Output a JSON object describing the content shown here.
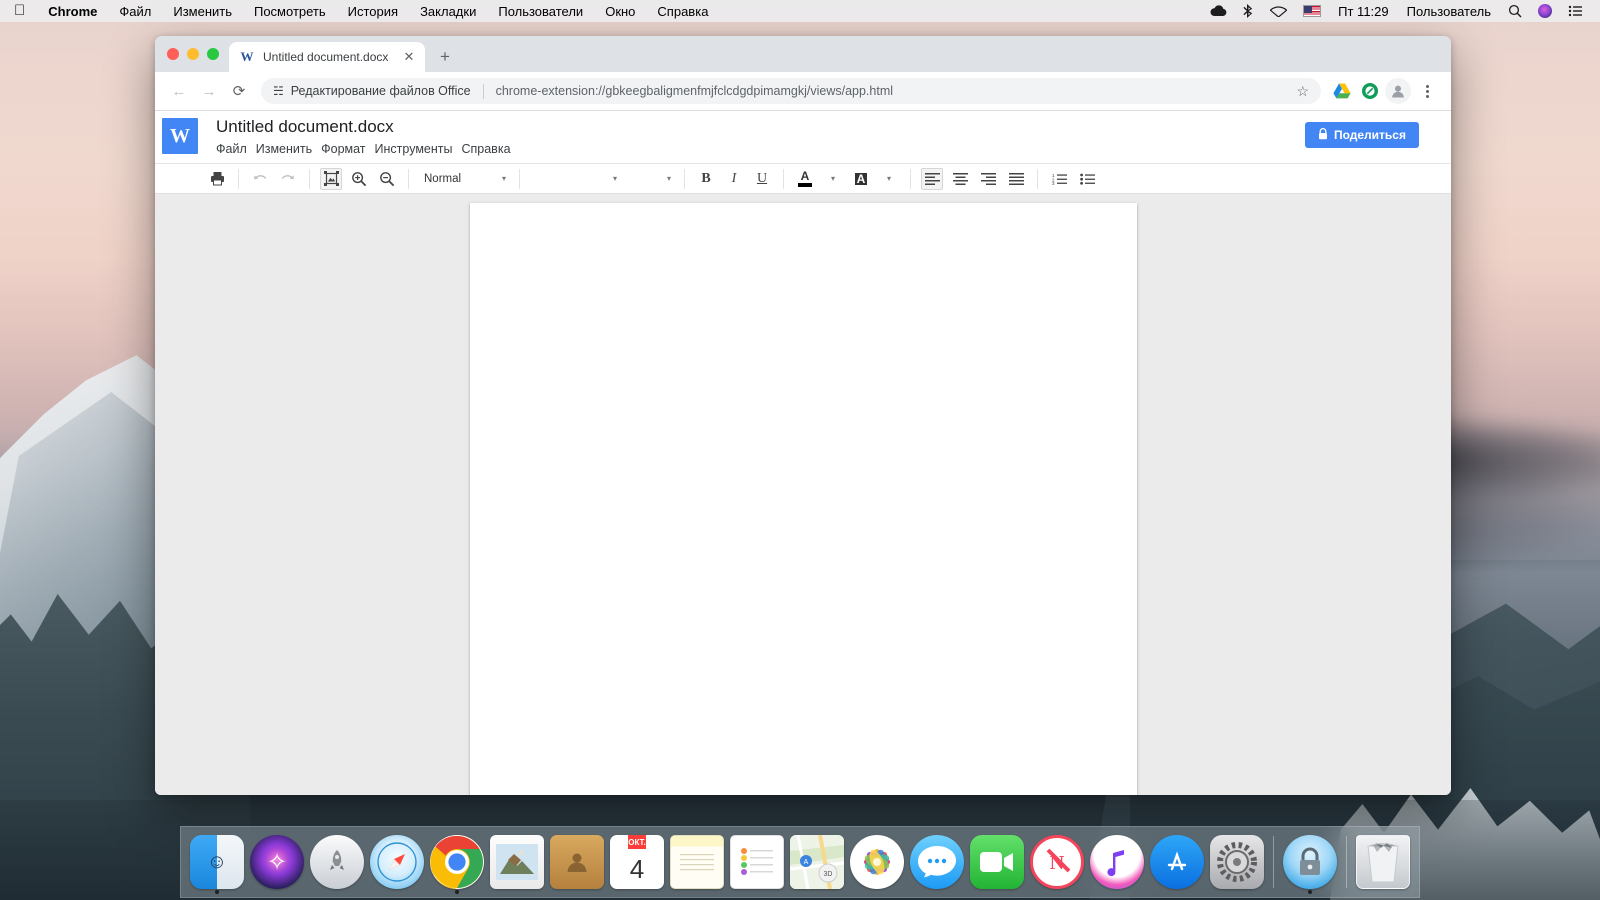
{
  "menubar": {
    "apple_icon": "apple-logo",
    "app_name": "Chrome",
    "items": [
      "Файл",
      "Изменить",
      "Посмотреть",
      "История",
      "Закладки",
      "Пользователи",
      "Окно",
      "Справка"
    ],
    "right": {
      "cloud_icon": "cloud-icon",
      "bluetooth_icon": "bluetooth-icon",
      "wifi_icon": "wifi-icon",
      "flag_icon": "us-flag-icon",
      "clock": "Пт 11:29",
      "user": "Пользователь",
      "search_icon": "search-icon",
      "siri_icon": "siri-icon",
      "control_center_icon": "control-center-icon"
    }
  },
  "browser": {
    "tab": {
      "favicon_letter": "W",
      "title": "Untitled document.docx",
      "close_icon": "close-icon"
    },
    "new_tab_label": "+",
    "nav": {
      "back_icon": "back-arrow-icon",
      "forward_icon": "forward-arrow-icon",
      "reload_icon": "reload-icon"
    },
    "omnibox": {
      "extension_icon": "puzzle-piece-icon",
      "extension_name": "Редактирование файлов Office",
      "url": "chrome-extension://gbkeegbaligmenfmjfclcdgdpimamgkj/views/app.html",
      "star_icon": "bookmark-star-icon"
    },
    "toolbar_icons": {
      "drive_icon": "google-drive-icon",
      "extension2_icon": "extension-icon",
      "avatar_icon": "profile-avatar-icon",
      "menu_icon": "three-dot-menu-icon"
    }
  },
  "app": {
    "logo_letter": "W",
    "doc_name": "Untitled document.docx",
    "menu": [
      "Файл",
      "Изменить",
      "Формат",
      "Инструменты",
      "Справка"
    ],
    "share": {
      "label": "Поделиться",
      "icon": "lock-icon",
      "color": "#4285f4"
    }
  },
  "toolbar": {
    "print_icon": "print-icon",
    "undo_icon": "undo-icon",
    "redo_icon": "redo-icon",
    "image_icon": "insert-image-icon",
    "zoom_in_icon": "zoom-in-icon",
    "zoom_out_icon": "zoom-out-icon",
    "style_value": "Normal",
    "font_value": "",
    "size_value": "",
    "bold_label": "B",
    "italic_label": "I",
    "underline_label": "U",
    "text_color_label": "A",
    "text_color": "#000000",
    "highlight_label": "A",
    "align_left_icon": "align-left-icon",
    "align_center_icon": "align-center-icon",
    "align_right_icon": "align-right-icon",
    "align_justify_icon": "align-justify-icon",
    "numbered_list_icon": "numbered-list-icon",
    "bullet_list_icon": "bullet-list-icon",
    "caret": "▾"
  },
  "document": {
    "content": "",
    "background": "#ebebeb"
  },
  "dock": {
    "items": [
      {
        "name": "finder",
        "running": true
      },
      {
        "name": "siri",
        "running": false
      },
      {
        "name": "launchpad",
        "running": false
      },
      {
        "name": "safari",
        "running": false
      },
      {
        "name": "chrome",
        "running": true
      },
      {
        "name": "mail",
        "running": false
      },
      {
        "name": "contacts",
        "running": false
      },
      {
        "name": "calendar",
        "running": false,
        "month": "ОКТ.",
        "day": "4"
      },
      {
        "name": "notes",
        "running": false
      },
      {
        "name": "reminders",
        "running": false
      },
      {
        "name": "maps",
        "running": false
      },
      {
        "name": "photos",
        "running": false
      },
      {
        "name": "messages",
        "running": false
      },
      {
        "name": "facetime",
        "running": false
      },
      {
        "name": "news",
        "running": false
      },
      {
        "name": "itunes",
        "running": false
      },
      {
        "name": "app-store",
        "running": false
      },
      {
        "name": "system-preferences",
        "running": false
      },
      {
        "name": "keychain-lock",
        "running": true
      },
      {
        "name": "trash",
        "running": false
      }
    ]
  }
}
